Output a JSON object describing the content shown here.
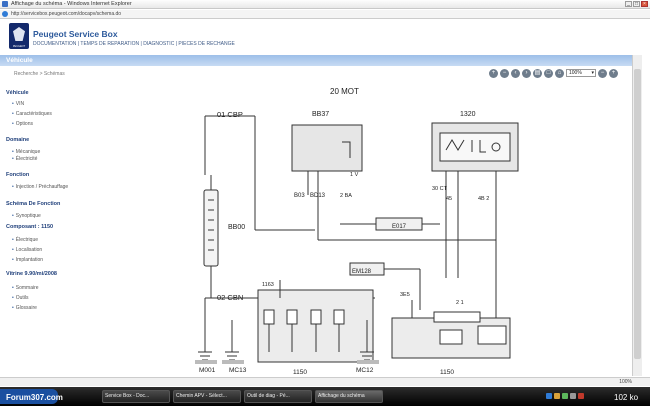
{
  "window": {
    "title": "Affichage du schéma - Windows Internet Explorer",
    "url": "http://servicebox.peugeot.com/docapv/schema.do"
  },
  "header": {
    "logo_text": "PEUGEOT",
    "app_title": "Peugeot Service Box",
    "menu": "DOCUMENTATION | TEMPS DE REPARATION | DIAGNOSTIC | PIECES DE RECHANGE"
  },
  "tab": {
    "label": "Véhicule"
  },
  "breadcrumb": "Recherche > Schémas",
  "toolbar": {
    "zoom_value": "100%",
    "buttons": [
      "zoom-in",
      "zoom-out",
      "previous",
      "next",
      "print",
      "fit",
      "home"
    ]
  },
  "sidebar": {
    "sections": [
      {
        "title": "Véhicule",
        "items": [
          "VIN",
          "Caractéristiques",
          "Options"
        ]
      },
      {
        "title": "Domaine",
        "items": [
          "Mécanique",
          "Électricité"
        ]
      },
      {
        "title": "Fonction",
        "items": [
          "Injection / Préchauffage"
        ]
      },
      {
        "title": "Schéma De Fonction",
        "items": [
          "Synoptique"
        ]
      },
      {
        "title": "Composant : 1150",
        "items": [
          "Électrique",
          "Localisation",
          "Implantation"
        ]
      },
      {
        "title": "Vitrine 9.90/mi/2008",
        "items": [
          "Sommaire",
          "Outils",
          "Glossaire"
        ]
      }
    ]
  },
  "diagram": {
    "title": "20 MOT",
    "connectors": [
      "01 CBP",
      "02 CBN"
    ],
    "components": [
      "BB37",
      "1320",
      "BB00",
      "1150"
    ],
    "wire_labels": [
      "B03",
      "BD13",
      "2 BA",
      "1 V",
      "4B 2",
      "E017",
      "EM128",
      "1163",
      "30 CT",
      "45",
      "3E5",
      "2 1"
    ],
    "ground_points": [
      "M001",
      "MC13",
      "MC12"
    ],
    "bottom_labels": [
      "1150",
      "1150"
    ]
  },
  "status": {
    "zoom": "100%"
  },
  "taskbar": {
    "brand": "Forum307.com",
    "tasks": [
      "Service Box - Doc...",
      "Chemin APV - Sélect...",
      "Outil de diag - Pé...",
      "Affichage du schéma"
    ],
    "active_task": 3,
    "clock": "102 ko"
  },
  "colors": {
    "accent": "#2d5a9c",
    "tab": "#9dbfe8",
    "logo": "#13296b"
  }
}
